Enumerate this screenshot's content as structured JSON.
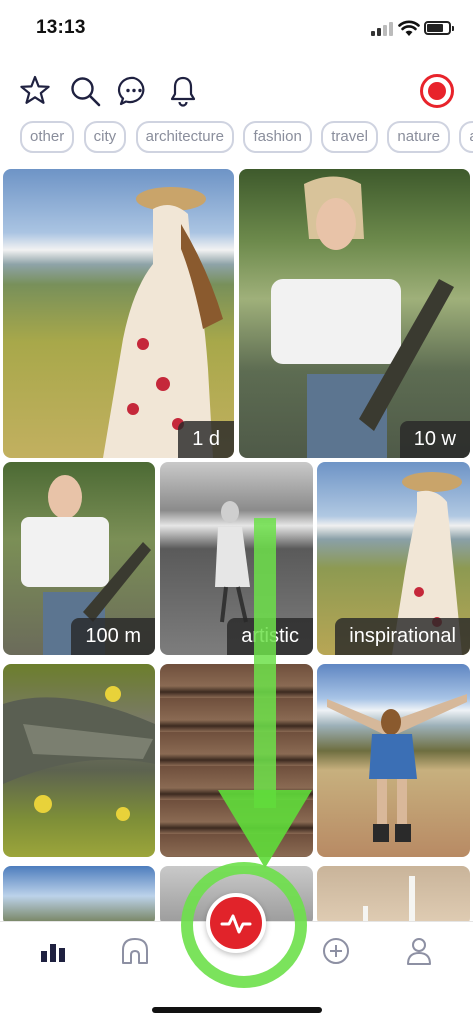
{
  "status_bar": {
    "time": "13:13"
  },
  "toolbar": {
    "icons": [
      "star-icon",
      "search-icon",
      "chat-icon",
      "bell-icon"
    ],
    "record_color": "#e8232b"
  },
  "categories": [
    "other",
    "city",
    "architecture",
    "fashion",
    "travel",
    "nature",
    "adv"
  ],
  "grid": {
    "tiles": [
      {
        "label": "1 d"
      },
      {
        "label": "10 w"
      },
      {
        "label": "100 m"
      },
      {
        "label": "artistic"
      },
      {
        "label": "inspirational"
      }
    ]
  },
  "bottom_nav": {
    "items": [
      "chart-icon",
      "home-icon",
      "activity-icon",
      "add-icon",
      "profile-icon"
    ],
    "center_color": "#e1232a"
  },
  "annotation": {
    "color": "#5fdc3a",
    "meaning": "swipe-down-arrow"
  }
}
